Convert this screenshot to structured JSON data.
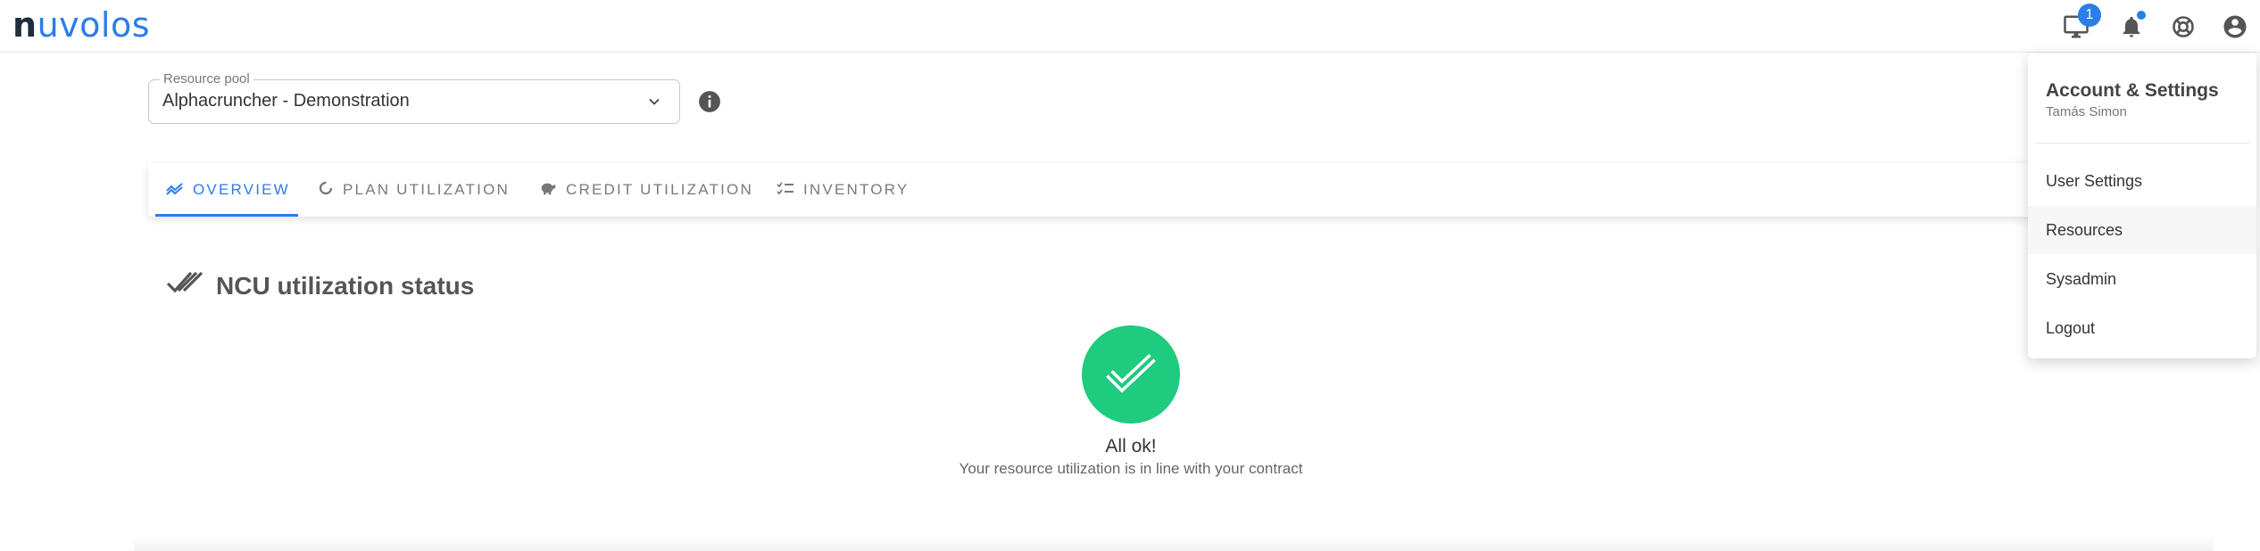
{
  "app": {
    "logo_first": "n",
    "logo_rest": "uvolos",
    "notifications_badge": "1"
  },
  "icons": {
    "desktop": "desktop-icon",
    "bell": "bell-icon",
    "support": "lifebuoy-icon",
    "account": "account-circle-icon",
    "info": "info-icon",
    "chevron": "chevron-down-icon"
  },
  "resource_pool": {
    "label": "Resource pool",
    "value": "Alphacruncher - Demonstration"
  },
  "tabs": [
    {
      "label": "Overview",
      "icon": "trend-icon",
      "active": true
    },
    {
      "label": "Plan utilization",
      "icon": "donut-icon",
      "active": false
    },
    {
      "label": "Credit utilization",
      "icon": "piggy-bank-icon",
      "active": false
    },
    {
      "label": "Inventory",
      "icon": "checklist-icon",
      "active": false
    }
  ],
  "status": {
    "title": "NCU utilization status",
    "ok_title": "All ok!",
    "ok_message": "Your resource utilization is in line with your contract"
  },
  "account_menu": {
    "title": "Account & Settings",
    "user": "Tamás Simon",
    "items": [
      {
        "label": "User Settings"
      },
      {
        "label": "Resources"
      },
      {
        "label": "Sysadmin"
      },
      {
        "label": "Logout"
      }
    ]
  },
  "colors": {
    "accent": "#2b7de9",
    "success": "#1ecb7f"
  }
}
